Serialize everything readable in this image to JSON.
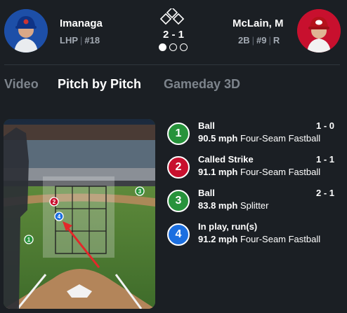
{
  "pitcher": {
    "name": "Imanaga",
    "hand": "LHP",
    "number": "#18"
  },
  "batter": {
    "name": "McLain, M",
    "position": "2B",
    "number": "#9",
    "bats": "R"
  },
  "situation": {
    "count": "2 - 1",
    "outs": 1,
    "outs_max": 3,
    "bases_occupied": []
  },
  "tabs": [
    {
      "label": "Video",
      "active": false
    },
    {
      "label": "Pitch by Pitch",
      "active": true
    },
    {
      "label": "Gameday 3D",
      "active": false
    }
  ],
  "pitches": [
    {
      "num": "1",
      "result": "Ball",
      "count": "1 - 0",
      "speed": "90.5 mph",
      "type": "Four-Seam Fastball",
      "color": "#27933b"
    },
    {
      "num": "2",
      "result": "Called Strike",
      "count": "1 - 1",
      "speed": "91.1 mph",
      "type": "Four-Seam Fastball",
      "color": "#c8102e"
    },
    {
      "num": "3",
      "result": "Ball",
      "count": "2 - 1",
      "speed": "83.8 mph",
      "type": "Splitter",
      "color": "#27933b"
    },
    {
      "num": "4",
      "result": "In play, run(s)",
      "count": "",
      "speed": "91.2 mph",
      "type": "Four-Seam Fastball",
      "color": "#1c6fe0"
    }
  ],
  "colors": {
    "ball": "#27933b",
    "strike": "#c8102e",
    "in_play": "#1c6fe0",
    "background": "#1b1f24",
    "annotation_arrow": "#e3282a"
  }
}
